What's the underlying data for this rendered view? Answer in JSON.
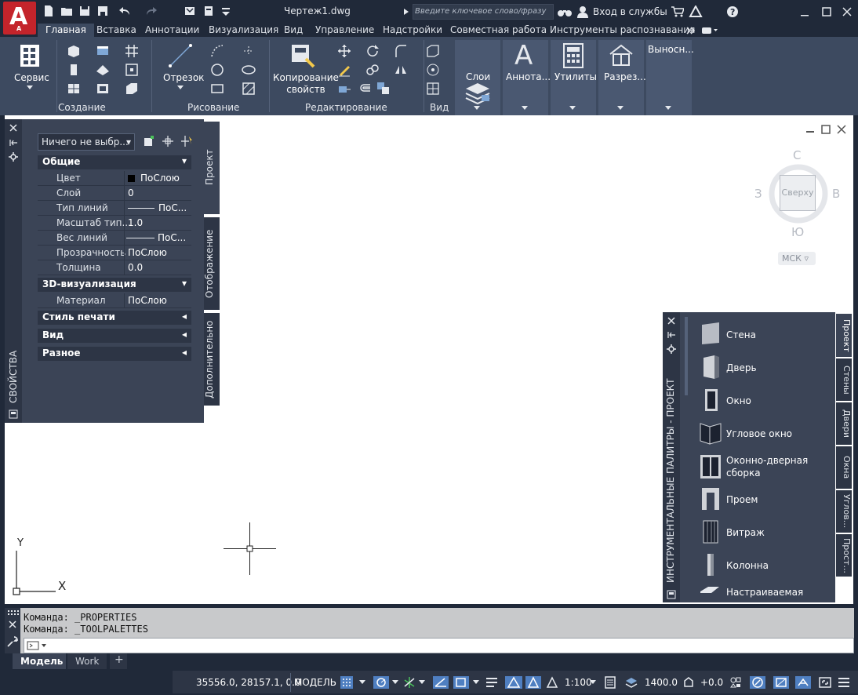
{
  "title_bar": {
    "document": "Чертеж1.dwg",
    "search_placeholder": "Введите ключевое слово/фразу",
    "login": "Вход в службы",
    "app_letter": "A",
    "app_sub": "A"
  },
  "ribbon_tabs": [
    "Главная",
    "Вставка",
    "Аннотации",
    "Визуализация",
    "Вид",
    "Управление",
    "Надстройки",
    "Совместная работа",
    "Инструменты распознавания"
  ],
  "ribbon": {
    "service": "Сервис",
    "otrezok": "Отрезок",
    "copy_props_1": "Копирование",
    "copy_props_2": "свойств",
    "layers": "Слои",
    "annot": "Аннота...",
    "utils": "Утилиты",
    "section": "Разрез...",
    "callout": "Выносн...",
    "panels": {
      "creation": "Создание",
      "drawing": "Рисование",
      "editing": "Редактирование",
      "view": "Вид"
    }
  },
  "viewcube": {
    "north": "С",
    "south": "Ю",
    "west": "З",
    "east": "В",
    "face": "Сверху",
    "ucs": "МСК"
  },
  "properties": {
    "selection": "Ничего не выбр...",
    "palette_title": "СВОЙСТВА",
    "tabs": [
      "Проект",
      "Отображение",
      "Дополнительно"
    ],
    "sections": {
      "general": "Общие",
      "viz3d": "3D-визуализация",
      "plot_style": "Стиль печати",
      "view": "Вид",
      "misc": "Разное"
    },
    "rows": [
      {
        "key": "Цвет",
        "value": "ПоСлою"
      },
      {
        "key": "Слой",
        "value": "0"
      },
      {
        "key": "Тип линий",
        "value": "ПоС..."
      },
      {
        "key": "Масштаб тип...",
        "value": "1.0"
      },
      {
        "key": "Вес линий",
        "value": "ПоС..."
      },
      {
        "key": "Прозрачность",
        "value": "ПоСлою"
      },
      {
        "key": "Толщина",
        "value": "0.0"
      }
    ],
    "material_key": "Материал",
    "material_value": "ПоСлою"
  },
  "tool_palette": {
    "title": "ИНСТРУМЕНТАЛЬНЫЕ ПАЛИТРЫ - ПРОЕКТ",
    "items": [
      "Стена",
      "Дверь",
      "Окно",
      "Угловое окно",
      "Оконно-дверная",
      "сборка",
      "Проем",
      "Витраж",
      "Колонна",
      "Настраиваемая"
    ],
    "tabs": [
      "Проект",
      "Стены",
      "Двери",
      "Окна",
      "Углов...",
      "Прост..."
    ]
  },
  "command_line": {
    "line1": "Команда:  _PROPERTIES",
    "line2": "Команда:  _TOOLPALETTES"
  },
  "layout_tabs": [
    "Модель",
    "Work",
    "+"
  ],
  "status_bar": {
    "coords": "35556.0, 28157.1, 0.0",
    "space": "МОДЕЛЬ",
    "scale": "1:100",
    "elevation": "1400.0",
    "offset": "+0.0"
  },
  "axes": {
    "x": "X",
    "y": "Y"
  }
}
